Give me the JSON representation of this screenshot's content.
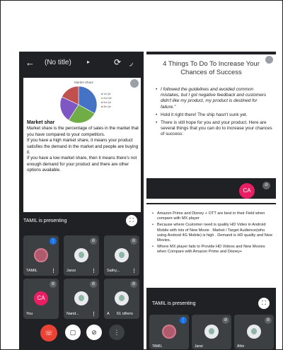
{
  "left_phone": {
    "title": "(No title)",
    "slide": {
      "chart_title": "Market Share",
      "legend": [
        "1st Qtr",
        "2nd Qtr",
        "3rd Qtr",
        "4th Qtr"
      ],
      "heading": "Market shar",
      "body": "Market share is the percentage of sales in the market that you have compared to your competitors.\nIf you have a high market share, it means your product satisfies the demand in the market and people are buying it.\nIf you have a low market share, then it means there's not enough demand for your product and there are other options available."
    },
    "presenting_label": "TAMIL is presenting",
    "participants": [
      {
        "name": "TAMIL",
        "type": "photo",
        "state": "talking"
      },
      {
        "name": "Jansi",
        "type": "generic",
        "state": "muted"
      },
      {
        "name": "Sathy...",
        "type": "generic",
        "state": "muted"
      },
      {
        "name": "You",
        "type": "initials",
        "initials": "CA",
        "state": "muted"
      },
      {
        "name": "Nand...",
        "type": "generic",
        "state": "muted"
      },
      {
        "name": "A",
        "type": "generic",
        "state": "muted",
        "others": "61 others"
      }
    ]
  },
  "right_top": {
    "title": "4 Things To Do To Increase Your Chances of Success",
    "bullets": [
      "I followed the guidelines and avoided common mistakes, but I got negative feedback and customers didn't like my product, my product is destined for failure.\"",
      "Hold it right there! The ship hasn't sunk yet.",
      "There is still hope for you and your product.  Here are several things that you can do to increase your chances of success:"
    ],
    "self_initials": "CA"
  },
  "right_bottom": {
    "bullets": [
      "Amazon Prime and Disney +  OTT are best in their Field when compare with MX player",
      "Because where Customer need is quality HD Video in Android Mobile with lots of New Movie . Market / Target Audience(who using Android 4G Mobile) is high . Demand is HD quality and New Movies.",
      "Where MX player fails to Provide HD Videos and New Movies when Compare with Amazon Prime and Disney+"
    ],
    "presenting_label": "TAMIL is presenting",
    "participants": [
      "TAMIL",
      "Jansi",
      "Afrin"
    ]
  },
  "colors": {
    "app_bg": "#202124",
    "tile_bg": "#3c4043",
    "end_call": "#ea4335",
    "avatar_ca": "#e91e63",
    "speaking": "#1a73e8"
  },
  "chart_data": {
    "type": "pie",
    "title": "Market Share",
    "categories": [
      "1st Qtr",
      "2nd Qtr",
      "3rd Qtr",
      "4th Qtr"
    ],
    "values": [
      33,
      26,
      23,
      18
    ],
    "colors": [
      "#4472c4",
      "#70ad47",
      "#7e57c2",
      "#c0504d"
    ]
  }
}
